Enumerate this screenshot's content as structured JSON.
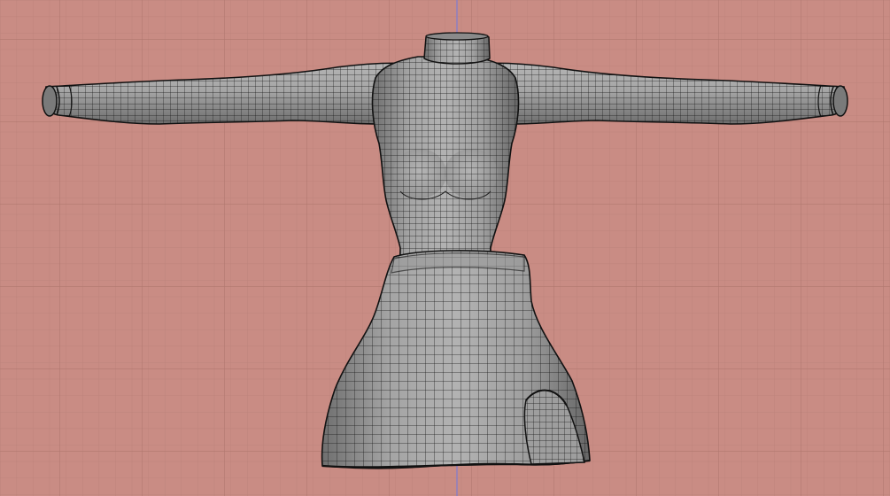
{
  "viewport": {
    "background_color": "#c98c84",
    "grid_minor_color": "#bd837b",
    "grid_major_color": "#b1786f",
    "axis_color": "#7f7bd1",
    "mesh_fill_color": "#8f8f8f",
    "mesh_wire_color": "#1a1a1a"
  },
  "object": {
    "kind": "garment-mesh",
    "parts": [
      "turtleneck-collar",
      "left-sleeve",
      "right-sleeve",
      "torso",
      "skirt",
      "skirt-slit"
    ]
  }
}
